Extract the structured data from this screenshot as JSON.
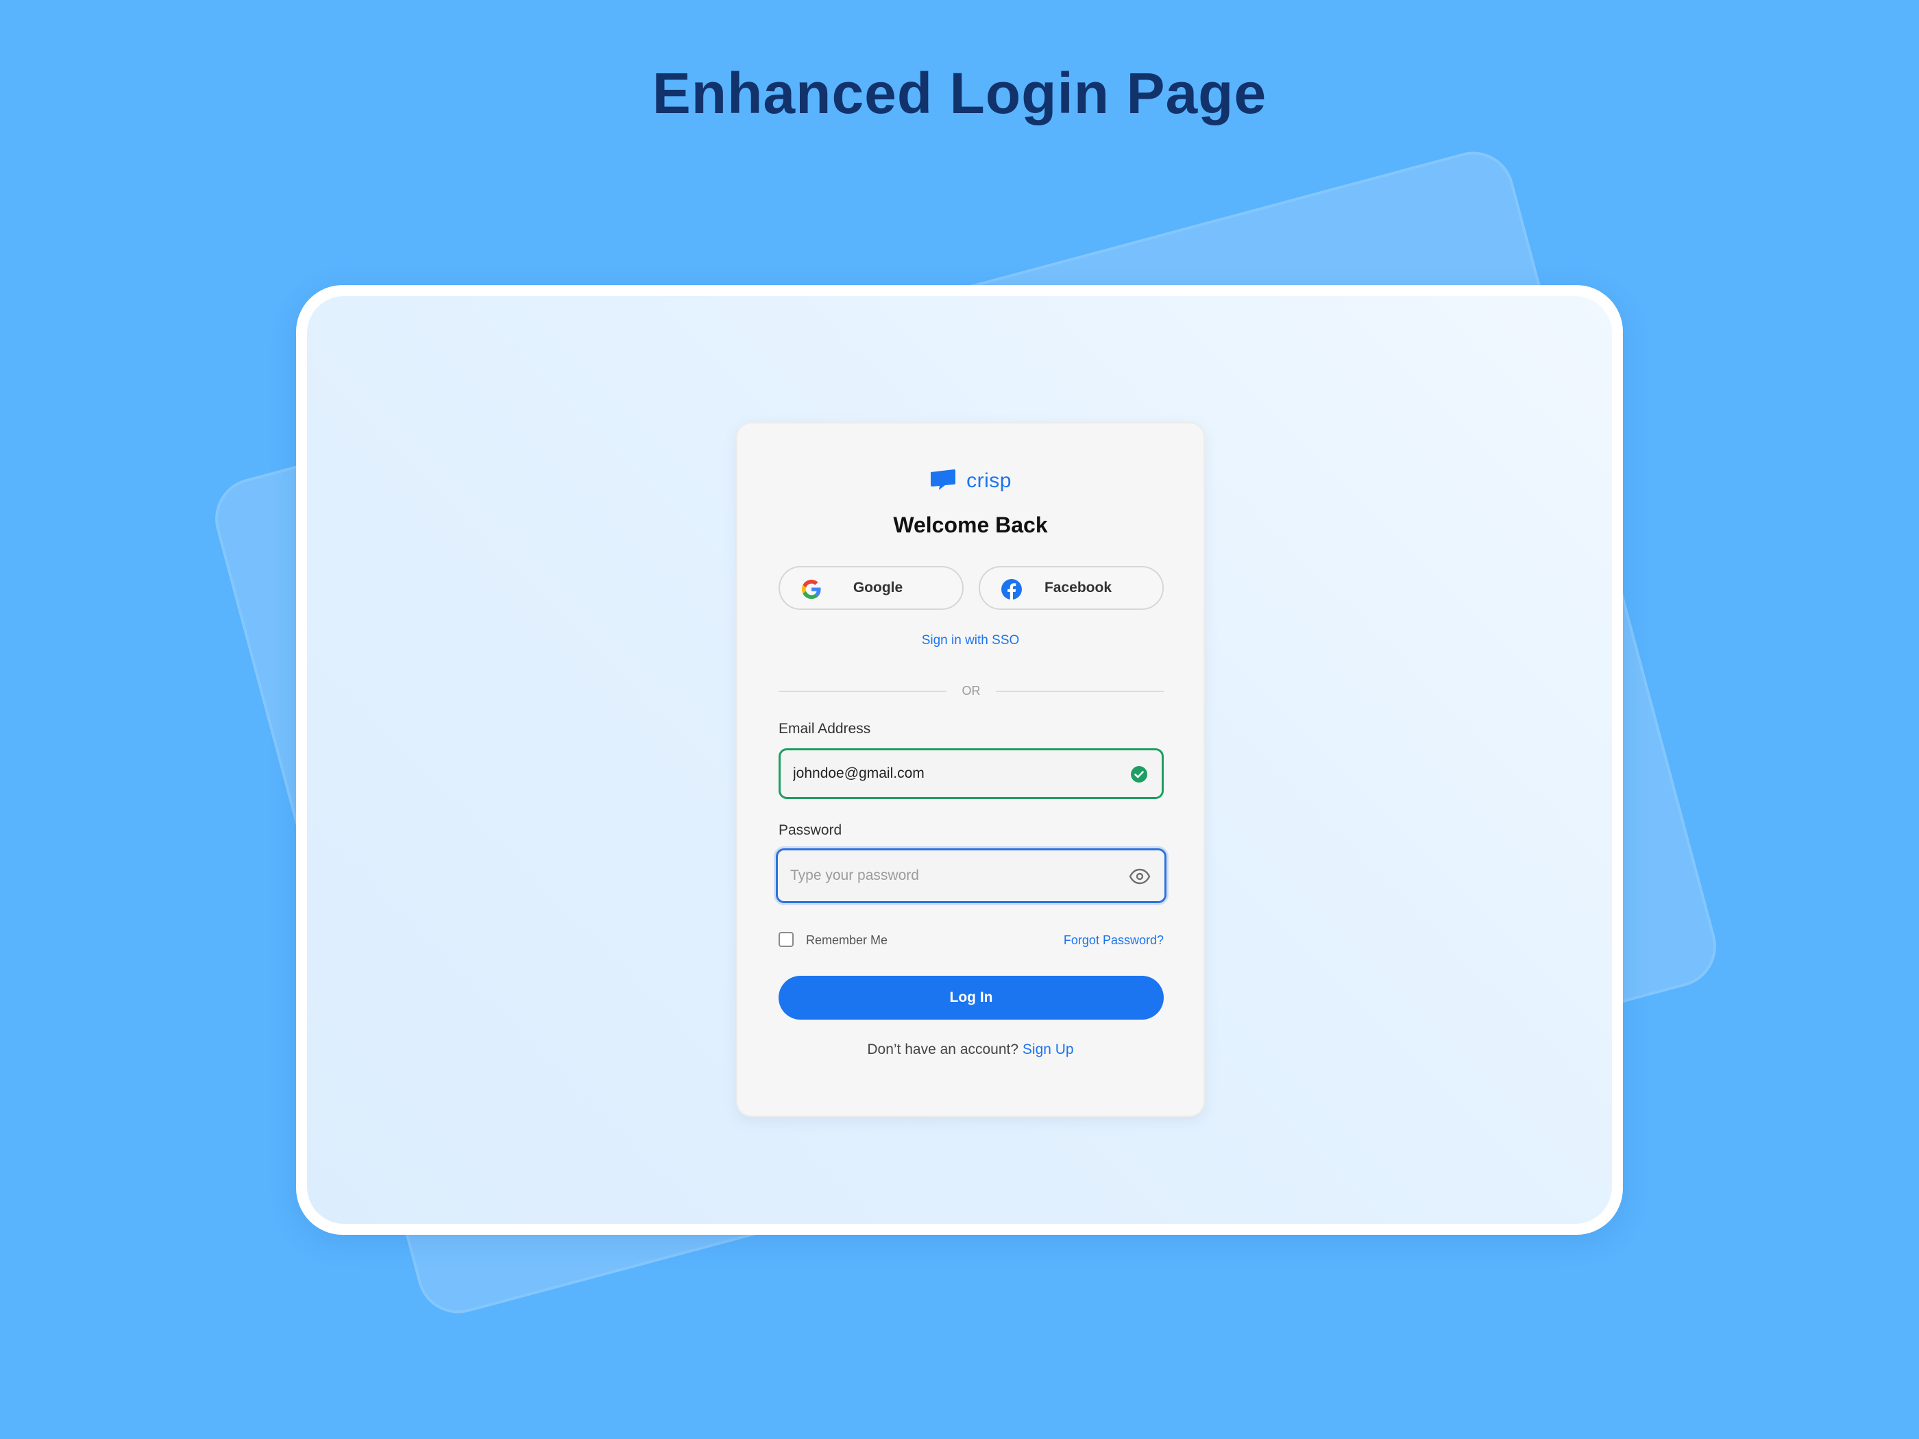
{
  "page": {
    "title": "Enhanced Login Page"
  },
  "brand": {
    "name": "crisp",
    "logo_icon": "speech-bubble-icon",
    "accent_color": "#1b74f0"
  },
  "login": {
    "heading": "Welcome Back",
    "social": {
      "google_label": "Google",
      "facebook_label": "Facebook"
    },
    "sso_link": "Sign in with SSO",
    "divider_text": "OR",
    "email": {
      "label": "Email Address",
      "value": "johndoe@gmail.com",
      "status": "valid",
      "status_color": "#1d9e62"
    },
    "password": {
      "label": "Password",
      "placeholder": "Type your password",
      "focus_color": "#2b73e0"
    },
    "remember_label": "Remember Me",
    "remember_checked": false,
    "forgot_link": "Forgot Password?",
    "submit_label": "Log In",
    "signup_prompt": "Don’t have an account?",
    "signup_link": "Sign Up"
  }
}
